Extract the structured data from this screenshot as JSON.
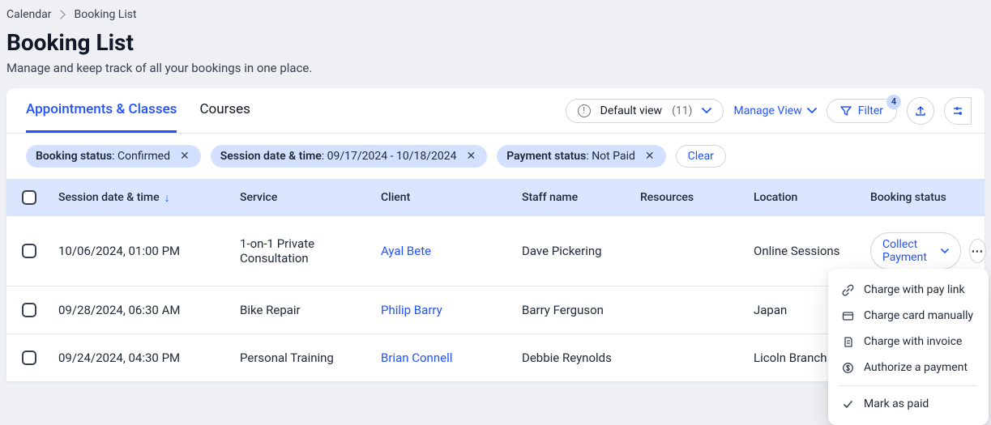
{
  "breadcrumb": {
    "root": "Calendar",
    "current": "Booking List"
  },
  "header": {
    "title": "Booking List",
    "subtitle": "Manage and keep track of all your bookings in one place."
  },
  "tabs": {
    "appointments": "Appointments & Classes",
    "courses": "Courses",
    "activeIndex": 0
  },
  "toolbar": {
    "viewName": "Default view",
    "viewCount": "(11)",
    "manageView": "Manage View",
    "filterLabel": "Filter",
    "filterBadge": "4"
  },
  "filters": {
    "chips": [
      {
        "key": "Booking status",
        "value": "Confirmed"
      },
      {
        "key": "Session date & time",
        "value": "09/17/2024 - 10/18/2024"
      },
      {
        "key": "Payment status",
        "value": "Not Paid"
      }
    ],
    "clear": "Clear"
  },
  "columns": {
    "sessionDate": "Session date & time",
    "service": "Service",
    "client": "Client",
    "staff": "Staff name",
    "resources": "Resources",
    "location": "Location",
    "bookingStatus": "Booking status"
  },
  "rows": [
    {
      "date": "10/06/2024, 01:00 PM",
      "service": "1-on-1 Private Consultation",
      "client": "Ayal Bete",
      "staff": "Dave Pickering",
      "resources": "",
      "location": "Online Sessions",
      "collect": "Collect Payment"
    },
    {
      "date": "09/28/2024, 06:30 AM",
      "service": "Bike Repair",
      "client": "Philip Barry",
      "staff": "Barry Ferguson",
      "resources": "",
      "location": "Japan",
      "collect": ""
    },
    {
      "date": "09/24/2024, 04:30 PM",
      "service": "Personal Training",
      "client": "Brian Connell",
      "staff": "Debbie Reynolds",
      "resources": "",
      "location": "Licoln Branch",
      "collect": ""
    }
  ],
  "dropdown": {
    "chargePayLink": "Charge with pay link",
    "chargeCard": "Charge card manually",
    "chargeInvoice": "Charge with invoice",
    "authorize": "Authorize a payment",
    "markPaid": "Mark as paid"
  }
}
